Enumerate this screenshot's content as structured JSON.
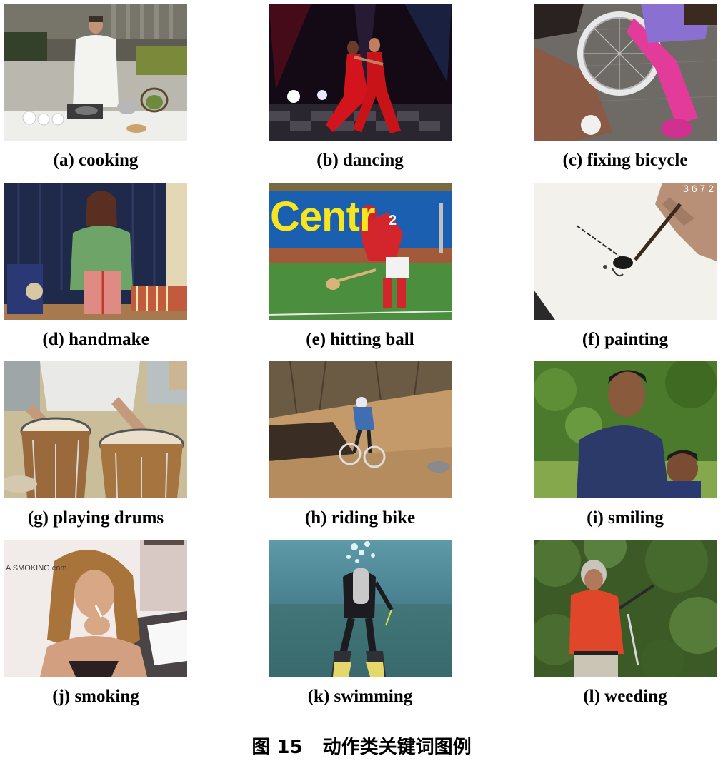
{
  "panels": [
    {
      "label": "(a) cooking"
    },
    {
      "label": "(b) dancing"
    },
    {
      "label": "(c) fixing bicycle"
    },
    {
      "label": "(d) handmake"
    },
    {
      "label": "(e) hitting ball",
      "overlay_text": "Centr",
      "jersey_number": "2"
    },
    {
      "label": "(f) painting",
      "overlay_text": "3 6 7 2"
    },
    {
      "label": "(g) playing drums"
    },
    {
      "label": "(h) riding bike"
    },
    {
      "label": "(i) smiling"
    },
    {
      "label": "(j) smoking",
      "overlay_text": "A SMOKING.com"
    },
    {
      "label": "(k) swimming"
    },
    {
      "label": "(l) weeding"
    }
  ],
  "figure_caption": {
    "number": "图 15",
    "text": "动作类关键词图例"
  }
}
